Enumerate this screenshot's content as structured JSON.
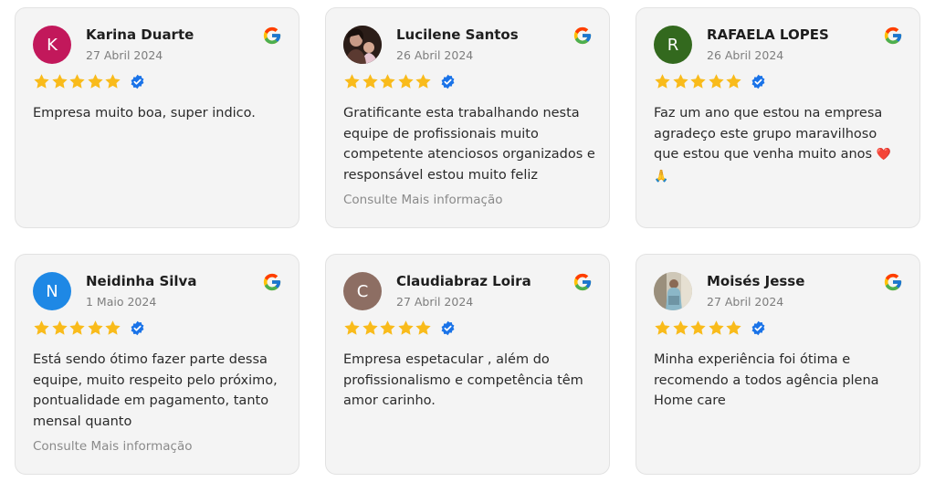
{
  "colors": {
    "star": "#f9bb1b",
    "verified": "#1a73e8",
    "card_bg": "#f4f4f4",
    "avatar_karina": "#c2185b",
    "avatar_rafaela": "#33691e",
    "avatar_neidinha": "#1e88e5",
    "avatar_claudia": "#8d6e63"
  },
  "read_more_label": "Consulte Mais informação",
  "reviews": [
    {
      "name": "Karina Duarte",
      "date": "27 Abril 2024",
      "avatar_initial": "K",
      "rating": 5,
      "text": "Empresa muito boa, super indico."
    },
    {
      "name": "Lucilene Santos",
      "date": "26 Abril 2024",
      "avatar": "photo",
      "rating": 5,
      "text": "Gratificante esta trabalhando nesta equipe de profissionais muito competente atenciosos organizados e responsável estou muito feliz"
    },
    {
      "name": "RAFAELA LOPES",
      "date": "26 Abril 2024",
      "avatar_initial": "R",
      "rating": 5,
      "text": "Faz um ano que estou na empresa agradeço este grupo maravilhoso que estou que venha muito anos",
      "emojis": "❤️🙏"
    },
    {
      "name": "Neidinha Silva",
      "date": "1 Maio 2024",
      "avatar_initial": "N",
      "rating": 5,
      "text": "Está sendo ótimo fazer parte dessa equipe, muito respeito pelo próximo, pontualidade em pagamento, tanto mensal quanto"
    },
    {
      "name": "Claudiabraz Loira",
      "date": "27 Abril 2024",
      "avatar_initial": "C",
      "rating": 5,
      "text": "Empresa espetacular , além do profissionalismo e competência têm amor carinho."
    },
    {
      "name": "Moisés Jesse",
      "date": "27 Abril 2024",
      "avatar": "photo",
      "rating": 5,
      "text": "Minha experiência foi ótima e recomendo a todos agência plena Home care"
    }
  ]
}
